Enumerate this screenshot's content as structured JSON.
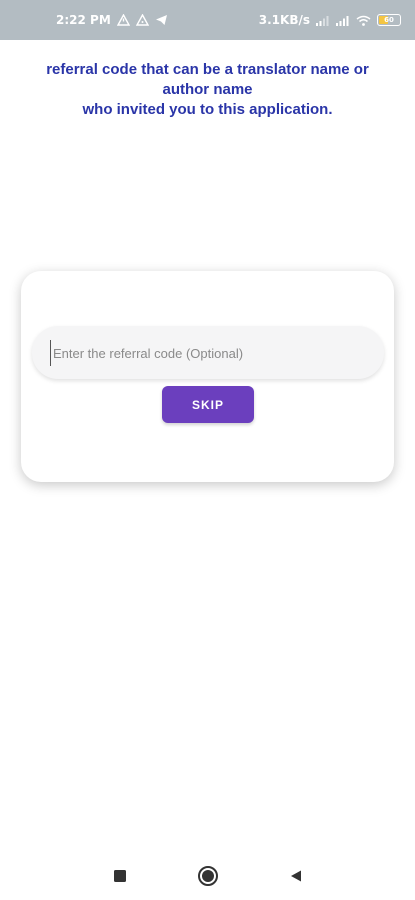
{
  "status_bar": {
    "time": "2:22 PM",
    "network_speed": "3.1KB/s",
    "battery_level": "60",
    "icons": [
      "alert-triangle-icon",
      "warning-icon",
      "telegram-icon",
      "signal-icon",
      "signal-icon",
      "wifi-icon",
      "battery-icon"
    ]
  },
  "header": {
    "line1": "referral code that can be a translator name or",
    "line2": "author name",
    "line3": "who invited you to this application."
  },
  "referral_card": {
    "input_placeholder": "Enter the referral code (Optional)",
    "input_value": "",
    "skip_label": "SKIP"
  },
  "colors": {
    "status_bar": "#b3bcc2",
    "header_text": "#2a35a8",
    "skip_button": "#6b3fbe"
  },
  "nav_bar": {
    "icons": [
      "recents-square-icon",
      "home-circle-icon",
      "back-triangle-icon"
    ]
  }
}
